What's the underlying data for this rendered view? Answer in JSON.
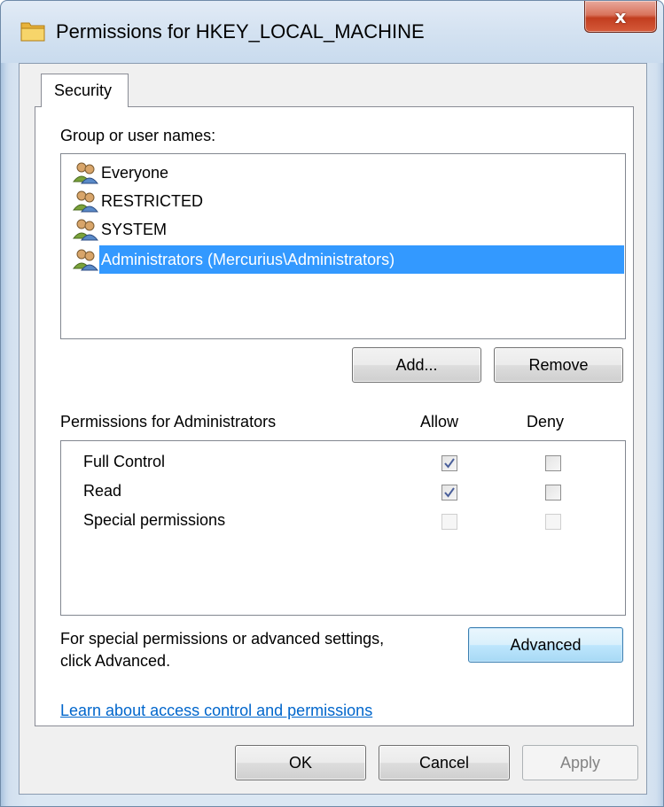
{
  "window": {
    "title": "Permissions for HKEY_LOCAL_MACHINE",
    "close_glyph": "x"
  },
  "tabs": [
    {
      "label": "Security",
      "active": true
    }
  ],
  "group_list": {
    "label": "Group or user names:",
    "items": [
      {
        "name": "Everyone",
        "selected": false
      },
      {
        "name": "RESTRICTED",
        "selected": false
      },
      {
        "name": "SYSTEM",
        "selected": false
      },
      {
        "name": "Administrators (Mercurius\\Administrators)",
        "selected": true
      }
    ]
  },
  "buttons": {
    "add": "Add...",
    "remove": "Remove",
    "advanced": "Advanced",
    "ok": "OK",
    "cancel": "Cancel",
    "apply": "Apply"
  },
  "permissions": {
    "label": "Permissions for Administrators",
    "allow_header": "Allow",
    "deny_header": "Deny",
    "rows": [
      {
        "name": "Full Control",
        "allow": true,
        "deny": false,
        "enabled": true
      },
      {
        "name": "Read",
        "allow": true,
        "deny": false,
        "enabled": true
      },
      {
        "name": "Special permissions",
        "allow": false,
        "deny": false,
        "enabled": false
      }
    ]
  },
  "advanced_info": {
    "line1": "For special permissions or advanced settings,",
    "line2": "click Advanced."
  },
  "help_link": "Learn about access control and permissions",
  "colors": {
    "selection": "#3399ff",
    "link": "#0066cc",
    "close_button": "#c23d1f"
  }
}
